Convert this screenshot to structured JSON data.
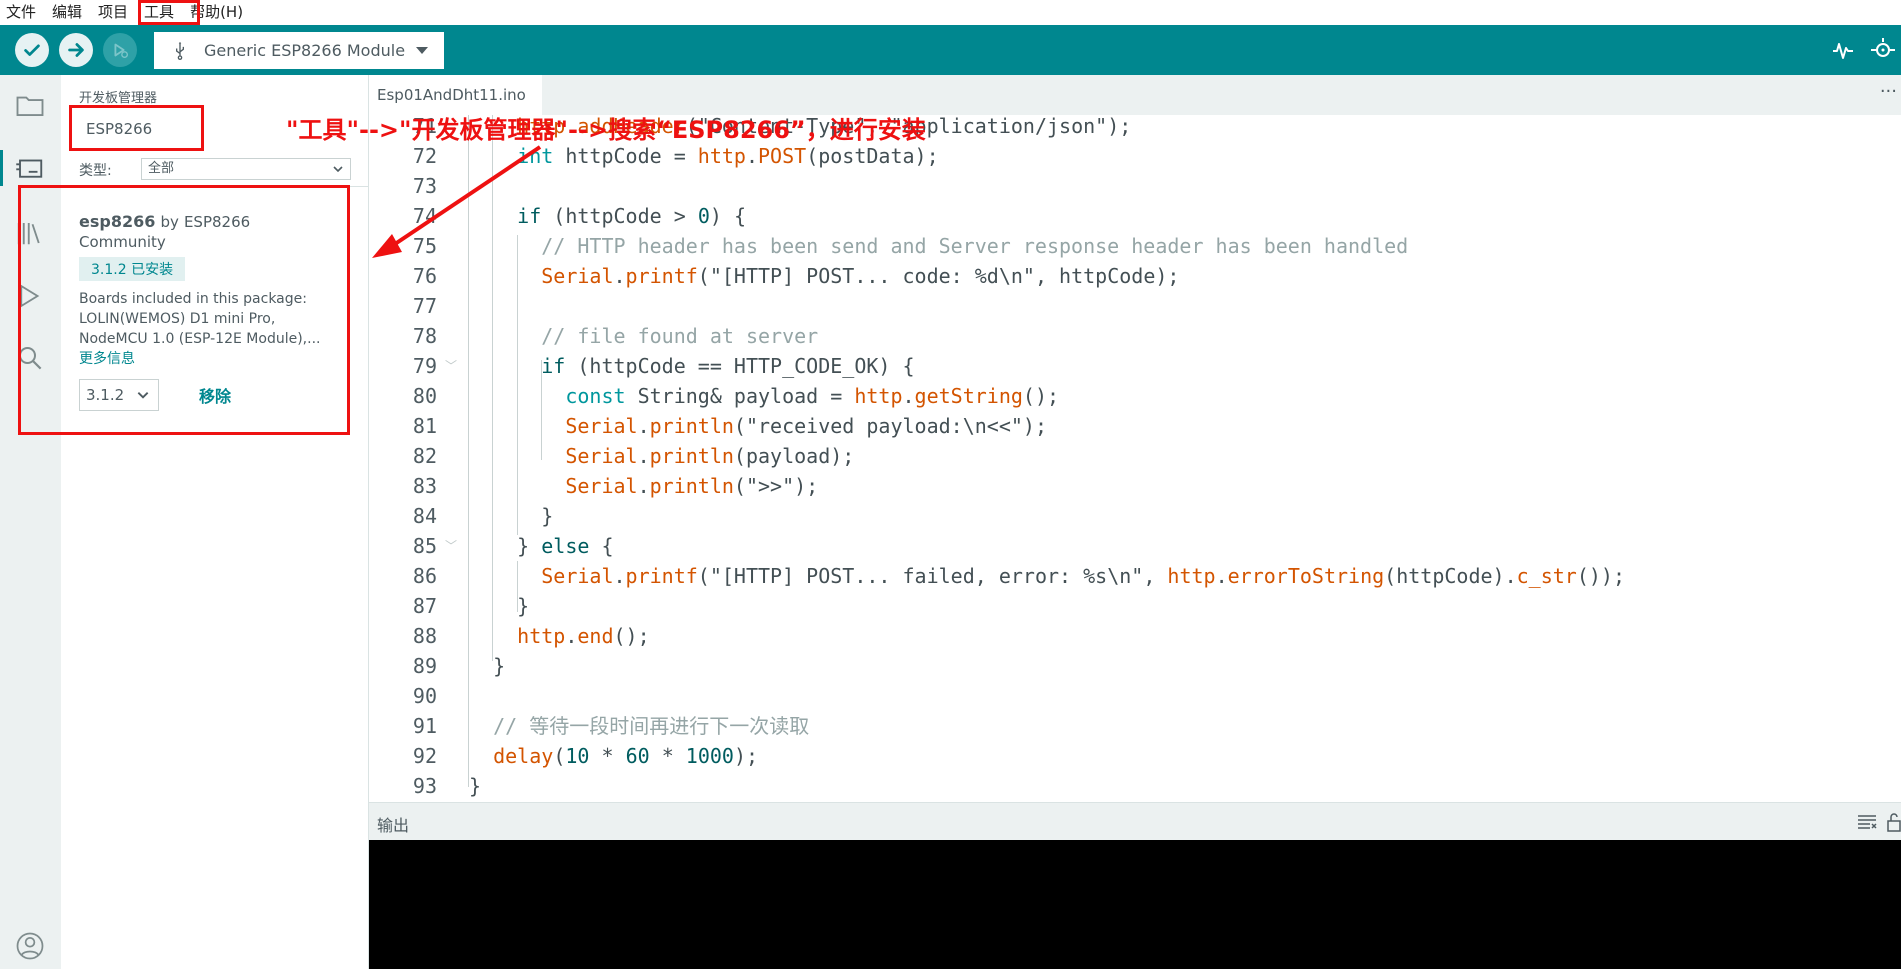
{
  "menu": {
    "items": [
      "文件",
      "编辑",
      "项目",
      "工具",
      "帮助(H)"
    ]
  },
  "toolbar": {
    "board_name": "Generic ESP8266 Module"
  },
  "board_manager": {
    "title": "开发板管理器",
    "search_value": "ESP8266",
    "type_label": "类型:",
    "type_value": "全部",
    "card": {
      "name": "esp8266",
      "by": "by",
      "author": "ESP8266",
      "community": "Community",
      "installed_badge": "3.1.2 已安装",
      "desc_line1": "Boards included in this package:",
      "desc_line2": "LOLIN(WEMOS) D1 mini Pro,",
      "desc_line3": "NodeMCU 1.0 (ESP-12E Module),...",
      "more_info": "更多信息",
      "version": "3.1.2",
      "remove_label": "移除"
    }
  },
  "editor": {
    "tab_name": "Esp01AndDht11.ino",
    "tab_more": "···"
  },
  "output": {
    "title": "输出"
  },
  "annotation": {
    "text": "\"工具\"-->\"开发板管理器\"-->搜索“ESP8266”，进行安装"
  },
  "colors": {
    "accent": "#00878f",
    "annotation_red": "#e11111",
    "console_bg": "#000000"
  }
}
